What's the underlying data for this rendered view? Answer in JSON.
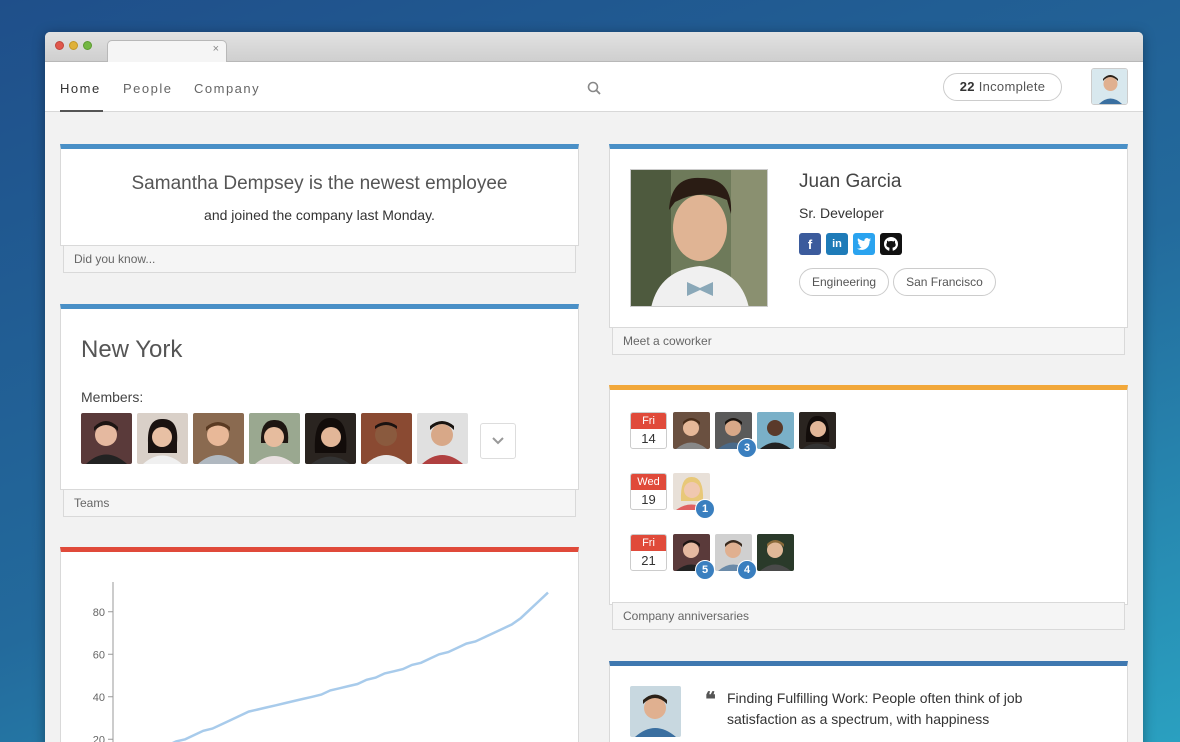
{
  "nav": {
    "items": [
      {
        "label": "Home",
        "active": true
      },
      {
        "label": "People",
        "active": false
      },
      {
        "label": "Company",
        "active": false
      }
    ],
    "incomplete_count": "22",
    "incomplete_label": "Incomplete"
  },
  "fact": {
    "line1": "Samantha Dempsey is the newest employee",
    "line2": "and joined the company last Monday.",
    "footer": "Did you know..."
  },
  "team": {
    "name": "New York",
    "members_label": "Members:",
    "member_count_shown": 7,
    "footer": "Teams"
  },
  "coworker": {
    "name": "Juan Garcia",
    "title": "Sr. Developer",
    "socials": [
      "facebook-icon",
      "linkedin-icon",
      "twitter-icon",
      "github-icon"
    ],
    "tags": [
      "Engineering",
      "San Francisco"
    ],
    "footer": "Meet a coworker"
  },
  "anniversaries": {
    "rows": [
      {
        "day": "Fri",
        "date": "14",
        "badges": [
          "",
          "3",
          "",
          ""
        ]
      },
      {
        "day": "Wed",
        "date": "19",
        "badges": [
          "1"
        ]
      },
      {
        "day": "Fri",
        "date": "21",
        "badges": [
          "5",
          "4",
          ""
        ]
      }
    ],
    "footer": "Company anniversaries"
  },
  "chart_data": {
    "type": "line",
    "yticks": [
      20,
      40,
      60,
      80
    ],
    "ylim": [
      14,
      94
    ],
    "x": [
      0,
      1,
      2,
      3,
      4,
      5,
      6,
      7,
      8,
      9,
      10,
      11,
      12,
      13,
      14,
      15,
      16,
      17,
      18,
      19,
      20,
      21,
      22,
      23,
      24,
      25,
      26,
      27,
      28,
      29,
      30,
      31,
      32,
      33,
      34,
      35,
      36,
      37,
      38,
      39,
      40,
      41,
      42,
      43
    ],
    "values": [
      15,
      17,
      19,
      20,
      22,
      24,
      25,
      27,
      29,
      31,
      33,
      34,
      35,
      36,
      37,
      38,
      39,
      40,
      41,
      43,
      44,
      45,
      46,
      48,
      49,
      51,
      52,
      53,
      55,
      56,
      58,
      60,
      61,
      63,
      65,
      66,
      68,
      70,
      72,
      74,
      77,
      81,
      85,
      89
    ],
    "color": "#a8cbeb"
  },
  "article": {
    "text": "Finding Fulfilling Work: People often think of job satisfaction as a spectrum, with happiness"
  },
  "colors": {
    "fact_border": "#4bb3d6",
    "team_border": "#4a8fcf",
    "coworker_border": "#4a8fcf",
    "anniv_border": "#f2a83a",
    "chart_border": "#e04a3a",
    "article_border": "#3f78b0"
  }
}
